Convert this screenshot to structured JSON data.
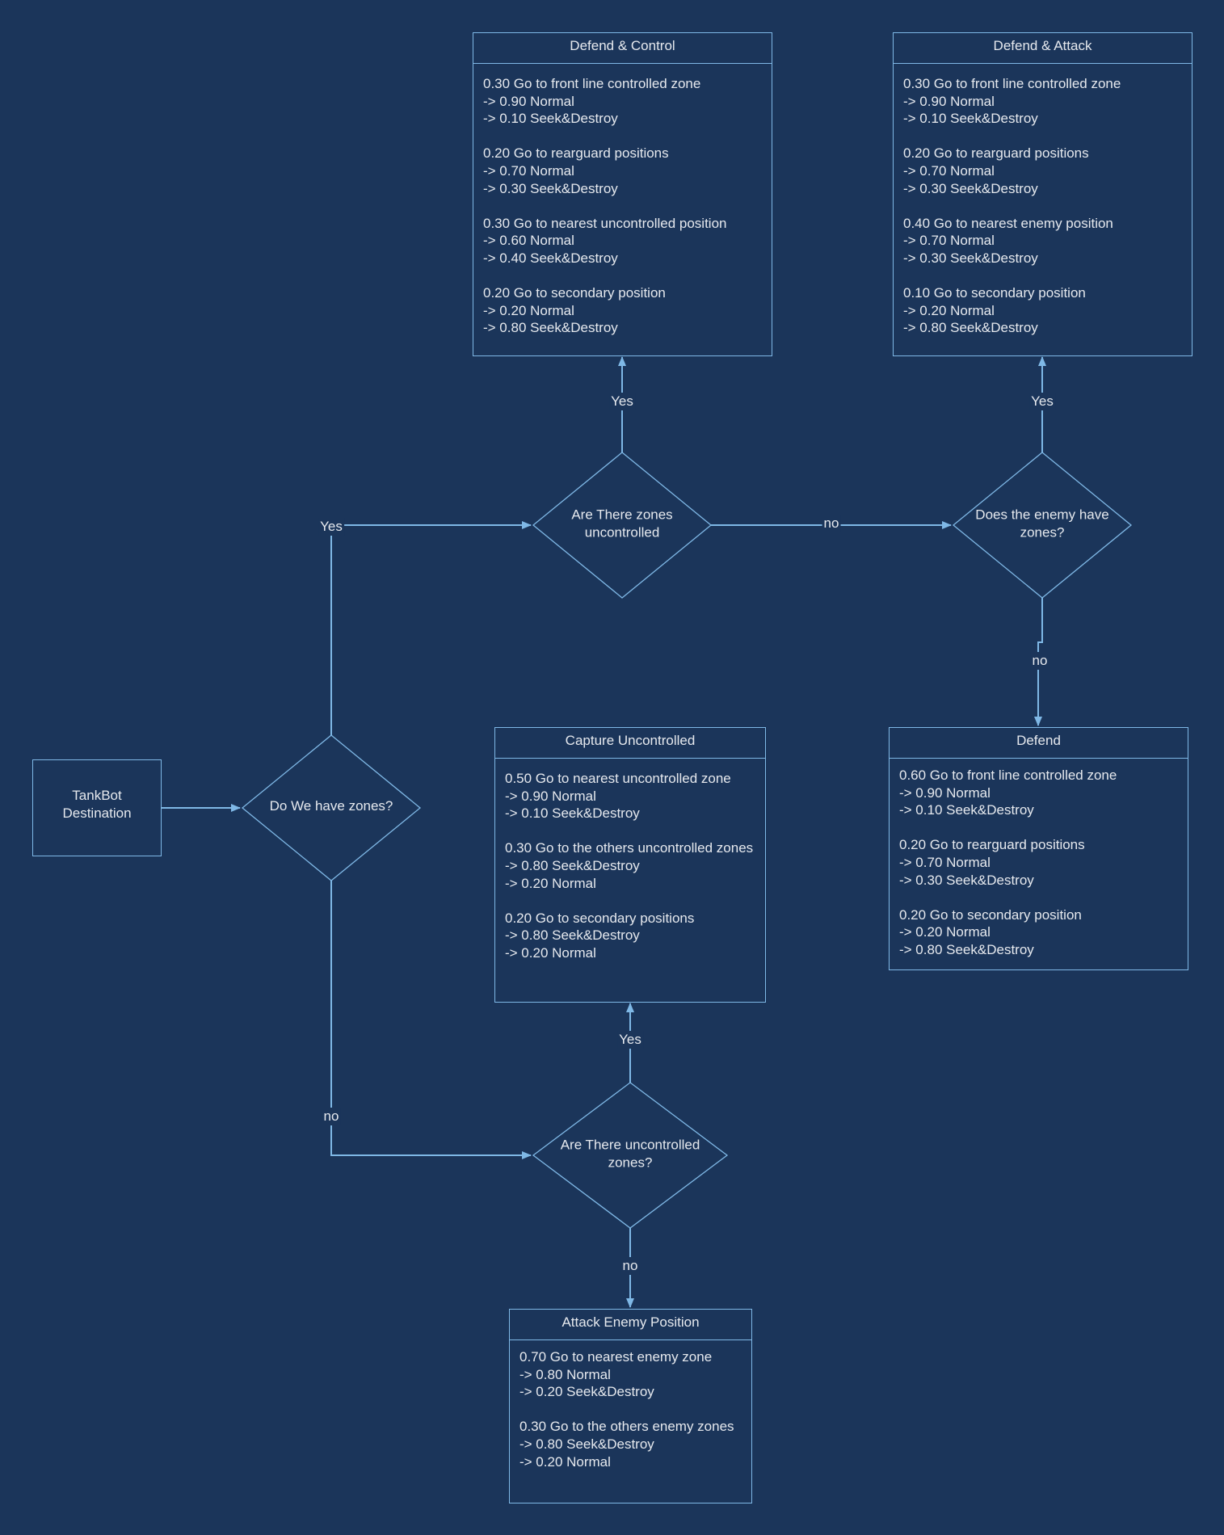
{
  "start": {
    "label_line1": "TankBot",
    "label_line2": "Destination"
  },
  "decisions": {
    "have_zones": {
      "line1": "Do We have zones?",
      "line2": ""
    },
    "zones_uncontrolled": {
      "line1": "Are There zones",
      "line2": "uncontrolled"
    },
    "enemy_zones": {
      "line1": "Does the enemy have",
      "line2": "zones?"
    },
    "uncontrolled_zones": {
      "line1": "Are There uncontrolled",
      "line2": "zones?"
    }
  },
  "edge_labels": {
    "have_zones_yes": "Yes",
    "have_zones_no": "no",
    "zones_uncontrolled_yes": "Yes",
    "zones_uncontrolled_no": "no",
    "enemy_zones_yes": "Yes",
    "enemy_zones_no": "no",
    "uncontrolled_yes": "Yes",
    "uncontrolled_no": "no"
  },
  "boxes": {
    "defend_control": {
      "title": "Defend & Control",
      "groups": [
        [
          "0.30 Go to front line controlled zone",
          "-> 0.90 Normal",
          "-> 0.10 Seek&Destroy"
        ],
        [
          "0.20 Go to rearguard positions",
          "-> 0.70 Normal",
          "-> 0.30 Seek&Destroy"
        ],
        [
          "0.30 Go to nearest uncontrolled position",
          "-> 0.60 Normal",
          "-> 0.40 Seek&Destroy"
        ],
        [
          "0.20 Go to secondary position",
          "-> 0.20 Normal",
          "-> 0.80 Seek&Destroy"
        ]
      ]
    },
    "defend_attack": {
      "title": "Defend & Attack",
      "groups": [
        [
          "0.30 Go to front line controlled zone",
          "-> 0.90 Normal",
          "-> 0.10 Seek&Destroy"
        ],
        [
          "0.20 Go to rearguard positions",
          "-> 0.70 Normal",
          "-> 0.30 Seek&Destroy"
        ],
        [
          "0.40 Go to nearest enemy position",
          "-> 0.70 Normal",
          "-> 0.30 Seek&Destroy"
        ],
        [
          "0.10 Go to secondary position",
          "-> 0.20 Normal",
          "-> 0.80 Seek&Destroy"
        ]
      ]
    },
    "capture_uncontrolled": {
      "title": "Capture Uncontrolled",
      "groups": [
        [
          "0.50 Go to nearest uncontrolled zone",
          "-> 0.90 Normal",
          "-> 0.10 Seek&Destroy"
        ],
        [
          "0.30 Go to the others uncontrolled zones",
          "-> 0.80 Seek&Destroy",
          "-> 0.20 Normal"
        ],
        [
          "0.20 Go to secondary positions",
          "-> 0.80 Seek&Destroy",
          "-> 0.20 Normal"
        ]
      ]
    },
    "defend": {
      "title": "Defend",
      "groups": [
        [
          "0.60 Go to front line controlled zone",
          "-> 0.90 Normal",
          "-> 0.10 Seek&Destroy"
        ],
        [
          "0.20 Go to rearguard positions",
          "-> 0.70 Normal",
          "-> 0.30 Seek&Destroy"
        ],
        [
          "0.20 Go to secondary position",
          "-> 0.20 Normal",
          "-> 0.80 Seek&Destroy"
        ]
      ]
    },
    "attack_enemy": {
      "title": "Attack Enemy Position",
      "groups": [
        [
          "0.70 Go to nearest enemy zone",
          "-> 0.80 Normal",
          "-> 0.20 Seek&Destroy"
        ],
        [
          "0.30 Go to the others enemy zones",
          "-> 0.80 Seek&Destroy",
          "-> 0.20 Normal"
        ]
      ]
    }
  }
}
